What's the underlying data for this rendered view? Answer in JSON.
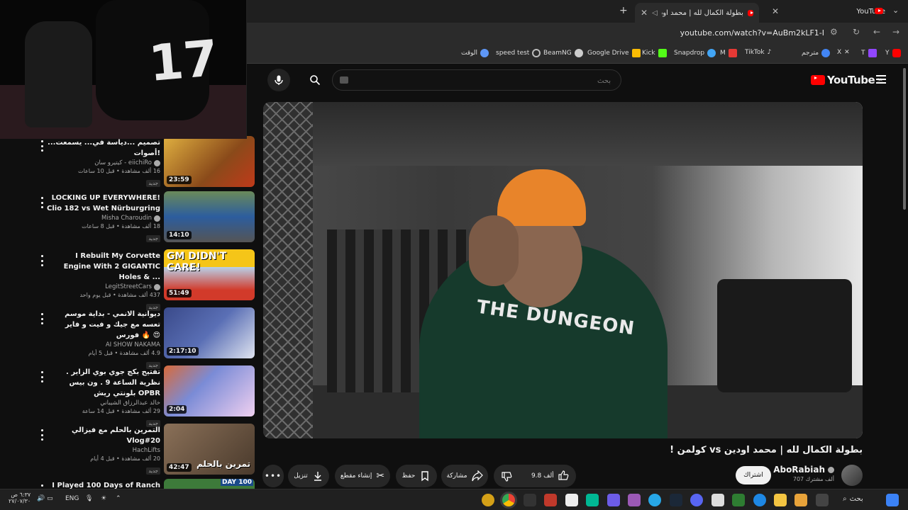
{
  "browser": {
    "tabs": [
      {
        "title": "YouTube"
      },
      {
        "title": "بطولة الكمال لله | محمد اودين vs كولمن"
      }
    ],
    "new_tab_label": "+",
    "url": "youtube.com/watch?v=AuBm2kLF1-I"
  },
  "bookmarks": [
    {
      "label": "Y",
      "color": "#ff0000"
    },
    {
      "label": "T",
      "color": "#9146ff"
    },
    {
      "label": "X",
      "color": "#ffffff"
    },
    {
      "label": "مترجم",
      "color": "#4285f4"
    },
    {
      "label": "TikTok",
      "color": "#ffffff"
    },
    {
      "label": "M",
      "color": "#e53935"
    },
    {
      "label": "Snapdrop",
      "color": "#42a5f5"
    },
    {
      "label": "Kick",
      "color": "#53fc18"
    },
    {
      "label": "Google Drive",
      "color": "#fbbc04"
    },
    {
      "label": "BeamNG",
      "color": "#cccccc"
    },
    {
      "label": "speed test",
      "color": "#bbbbbb"
    },
    {
      "label": "الوقت",
      "color": "#5e97f6"
    }
  ],
  "youtube": {
    "logo_text": "YouTube",
    "region": "SA",
    "search_placeholder": "بحث"
  },
  "video": {
    "title": "بطولة الكمال لله | محمد اودين vs كولمن !",
    "jersey_text": "THE DUNGEON",
    "channel": "AboRabiah",
    "subscribers": "707 ألف مشترك",
    "subscribe_label": "اشتراك",
    "likes": "9.8 ألف",
    "share_label": "مشاركة",
    "save_label": "حفظ",
    "clip_label": "إنشاء مقطع",
    "download_label": "تنزيل"
  },
  "sidebar": [
    {
      "title": "...تصميم ...دياسة في... يسمعت أصوات!",
      "channel": "كيتيرو سان - eiichiRo",
      "meta": "16 ألف مشاهدة • قبل 10 ساعات",
      "duration": "23:59",
      "new": "جديد",
      "thumb": "#b8862c"
    },
    {
      "title": "LOCKING UP EVERYWHERE! Clio 182 vs Wet Nürburgring",
      "channel": "Misha Charoudin",
      "meta": "18 ألف مشاهدة • قبل 8 ساعات",
      "duration": "14:10",
      "new": "جديد",
      "thumb": "#2c5d9e"
    },
    {
      "title": "I Rebuilt My Corvette Engine With 2 GIGANTIC Holes & ...",
      "channel": "LegitStreetCars",
      "meta": "437 ألف مشاهدة • قبل يوم واحد",
      "duration": "51:49",
      "new": "جديد",
      "thumb": "#d23a2a"
    },
    {
      "title": "ديوانية الانمي - بداية موسم تعسه مع جيك و فيت و فاير فورس 🔥 😍",
      "channel": "AI SHOW NAKAMA",
      "meta": "4.9 ألف مشاهدة • قبل 5 أيام",
      "duration": "2:17:10",
      "new": "جديد",
      "thumb": "#5a6fb5"
    },
    {
      "title": "تفتيح بكج جوي بوي الزاير . نظرية الساعة 9 . ون بيس بلونتي ريش OPBR",
      "channel": "خالد عبدالرزاق الشيباني",
      "meta": "29 ألف مشاهدة • قبل 14 ساعة",
      "duration": "2:04",
      "new": "جديد",
      "thumb": "#7a8bd6"
    },
    {
      "title": "التمرين بالحلم مع فيزالي Vlog#20",
      "channel": "HachLifts",
      "meta": "20 ألف مشاهدة • قبل 4 أيام",
      "duration": "42:47",
      "new": "جديد",
      "thumb": "#6b5a48",
      "overlay": "تمرين بالحلم"
    },
    {
      "title": "I Played 100 Days of Ranch",
      "channel": "",
      "meta": "",
      "duration": "",
      "new": "",
      "thumb": "#3d7a3a",
      "overlay": "DAY 100"
    }
  ],
  "taskbar": {
    "search_label": "بحث",
    "lang": "ENG",
    "time": "٦:٣٧ ص",
    "date": "٢٧/٠٧/٣٠"
  }
}
